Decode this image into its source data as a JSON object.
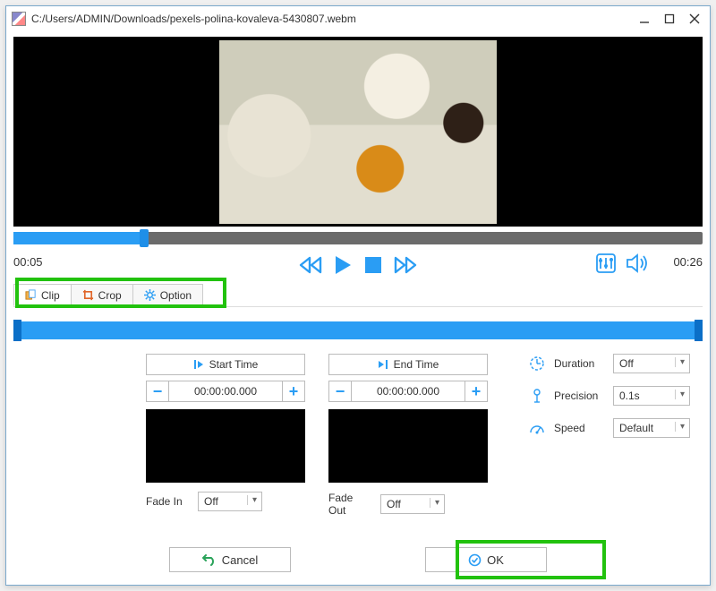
{
  "titlebar": {
    "path": "C:/Users/ADMIN/Downloads/pexels-polina-kovaleva-5430807.webm"
  },
  "playback": {
    "current_time": "00:05",
    "total_time": "00:26"
  },
  "tabs": {
    "clip": "Clip",
    "crop": "Crop",
    "option": "Option"
  },
  "start": {
    "button": "Start Time",
    "value": "00:00:00.000",
    "fade_label": "Fade In",
    "fade_value": "Off"
  },
  "end": {
    "button": "End Time",
    "value": "00:00:00.000",
    "fade_label": "Fade Out",
    "fade_value": "Off"
  },
  "props": {
    "duration_label": "Duration",
    "duration_value": "Off",
    "precision_label": "Precision",
    "precision_value": "0.1s",
    "speed_label": "Speed",
    "speed_value": "Default"
  },
  "buttons": {
    "cancel": "Cancel",
    "ok": "OK"
  }
}
